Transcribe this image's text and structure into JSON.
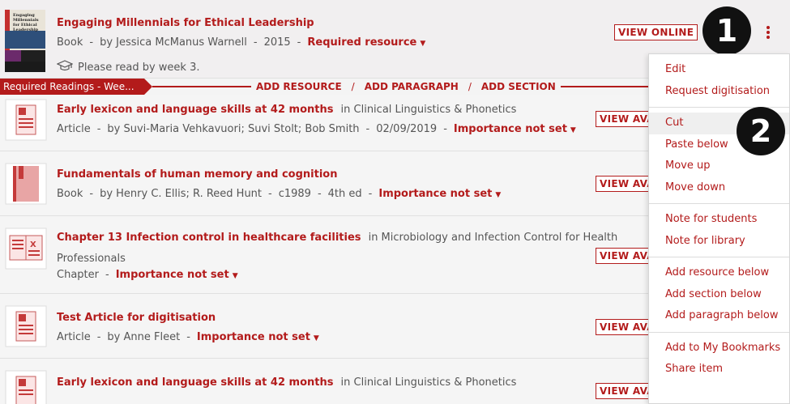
{
  "top_item": {
    "title": "Engaging Millennials for Ethical Leadership",
    "type": "Book",
    "author": "by Jessica McManus Warnell",
    "year": "2015",
    "status": "Required resource",
    "note": "Please read by week 3.",
    "view_label": "VIEW ONLINE"
  },
  "cover_lines": [
    "Engaging",
    "Millennials",
    "for Ethical",
    "Leadership"
  ],
  "badges": {
    "one": "1",
    "two": "2"
  },
  "section": {
    "name": "Required Readings - Wee...",
    "add_resource": "ADD RESOURCE",
    "add_paragraph": "ADD PARAGRAPH",
    "add_section": "ADD SECTION",
    "slash": "/"
  },
  "items": [
    {
      "title": "Early lexicon and language skills at 42 months",
      "in": "in Clinical Linguistics & Phonetics",
      "type": "Article",
      "author": "by Suvi-Maria Vehkavuori; Suvi Stolt; Bob Smith",
      "date": "02/09/2019",
      "importance": "Importance not set",
      "view_label": "VIEW AVAILABILITY"
    },
    {
      "title": "Fundamentals of human memory and cognition",
      "type": "Book",
      "author": "by Henry C. Ellis; R. Reed Hunt",
      "date": "c1989",
      "edition": "4th ed",
      "importance": "Importance not set",
      "view_label": "VIEW AVAILABILITY"
    },
    {
      "title": "Chapter 13 Infection control in healthcare facilities",
      "in": "in Microbiology and Infection Control for Health",
      "in_cont": "Professionals",
      "type": "Chapter",
      "importance": "Importance not set",
      "view_label": "VIEW AVAILABILITY"
    },
    {
      "title": "Test Article for digitisation",
      "type": "Article",
      "author": "by Anne Fleet",
      "importance": "Importance not set",
      "view_label": "VIEW AVAILABILITY"
    },
    {
      "title": "Early lexicon and language skills at 42 months",
      "in": "in Clinical Linguistics & Phonetics",
      "view_label": "VIEW AVAILABILITY"
    }
  ],
  "menu": {
    "groups": [
      [
        "Edit",
        "Request digitisation"
      ],
      [
        "Cut",
        "Paste below",
        "Move up",
        "Move down"
      ],
      [
        "Note for students",
        "Note for library"
      ],
      [
        "Add resource below",
        "Add section below",
        "Add paragraph below"
      ],
      [
        "Add to My Bookmarks",
        "Share item"
      ]
    ],
    "highlighted": "Cut"
  },
  "separators": {
    "dash": "-"
  },
  "icons": {
    "more": "kebab-menu-icon",
    "note": "graduation-cap-icon",
    "caret": "caret-down-icon"
  },
  "colors": {
    "accent": "#b31b1b",
    "background": "#f4f4f4",
    "badge": "#111111"
  }
}
